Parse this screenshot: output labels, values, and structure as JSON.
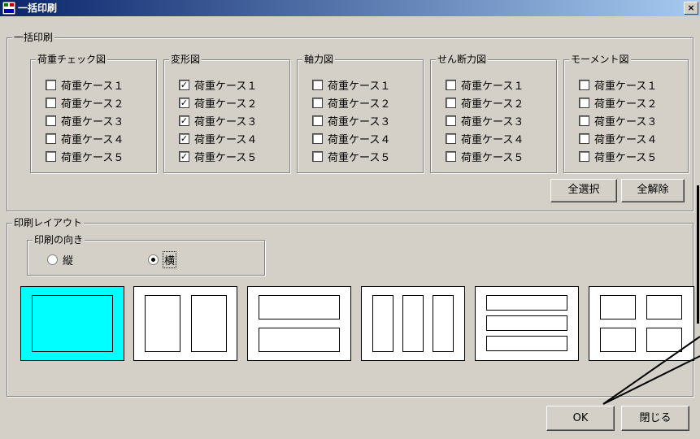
{
  "window": {
    "title": "一括印刷",
    "close_label": "×"
  },
  "batch_group": {
    "label": "一括印刷",
    "groups": [
      {
        "label": "荷重チェック図",
        "items": [
          {
            "label": "荷重ケース１",
            "checked": false
          },
          {
            "label": "荷重ケース２",
            "checked": false
          },
          {
            "label": "荷重ケース３",
            "checked": false
          },
          {
            "label": "荷重ケース４",
            "checked": false
          },
          {
            "label": "荷重ケース５",
            "checked": false
          }
        ]
      },
      {
        "label": "変形図",
        "items": [
          {
            "label": "荷重ケース１",
            "checked": true
          },
          {
            "label": "荷重ケース２",
            "checked": true
          },
          {
            "label": "荷重ケース３",
            "checked": true
          },
          {
            "label": "荷重ケース４",
            "checked": true
          },
          {
            "label": "荷重ケース５",
            "checked": true
          }
        ]
      },
      {
        "label": "軸力図",
        "items": [
          {
            "label": "荷重ケース１",
            "checked": false
          },
          {
            "label": "荷重ケース２",
            "checked": false
          },
          {
            "label": "荷重ケース３",
            "checked": false
          },
          {
            "label": "荷重ケース４",
            "checked": false
          },
          {
            "label": "荷重ケース５",
            "checked": false
          }
        ]
      },
      {
        "label": "せん断力図",
        "items": [
          {
            "label": "荷重ケース１",
            "checked": false
          },
          {
            "label": "荷重ケース２",
            "checked": false
          },
          {
            "label": "荷重ケース３",
            "checked": false
          },
          {
            "label": "荷重ケース４",
            "checked": false
          },
          {
            "label": "荷重ケース５",
            "checked": false
          }
        ]
      },
      {
        "label": "モーメント図",
        "items": [
          {
            "label": "荷重ケース１",
            "checked": false
          },
          {
            "label": "荷重ケース２",
            "checked": false
          },
          {
            "label": "荷重ケース３",
            "checked": false
          },
          {
            "label": "荷重ケース４",
            "checked": false
          },
          {
            "label": "荷重ケース５",
            "checked": false
          }
        ]
      }
    ],
    "select_all_label": "全選択",
    "clear_all_label": "全解除"
  },
  "layout_group": {
    "label": "印刷レイアウト",
    "orientation": {
      "label": "印刷の向き",
      "portrait_label": "縦",
      "landscape_label": "横",
      "selected": "landscape"
    },
    "selected_layout": 0,
    "selected_color": "#00ffff"
  },
  "footer": {
    "ok_label": "OK",
    "close_label": "閉じる"
  },
  "check_mark": "✓"
}
